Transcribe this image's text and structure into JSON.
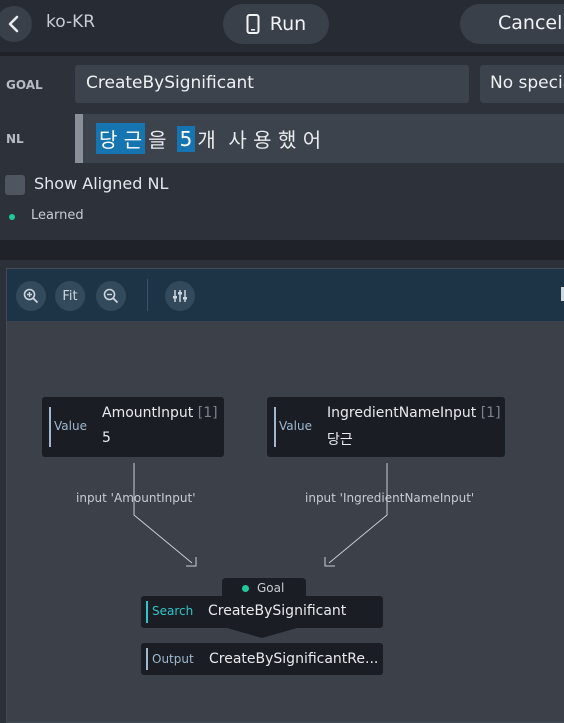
{
  "header": {
    "locale": "ko-KR",
    "run_label": "Run",
    "cancel_label": "Cancel"
  },
  "form": {
    "goal_label": "GOAL",
    "goal_value": "CreateBySignificant",
    "special_value": "No special",
    "nl_label": "NL",
    "nl_tokens": [
      {
        "text": "당 근",
        "highlight": true
      },
      {
        "text": "을",
        "highlight": false
      },
      {
        "text": "5",
        "highlight": true
      },
      {
        "text": "개  사 용 했 어",
        "highlight": false
      }
    ],
    "show_aligned_label": "Show Aligned NL",
    "status_label": "Learned"
  },
  "toolbar": {
    "zoom_in_icon": "zoom-in-icon",
    "fit_label": "Fit",
    "zoom_out_icon": "zoom-out-icon",
    "settings_icon": "sliders-icon"
  },
  "graph": {
    "amount_node": {
      "kind": "Value",
      "title": "AmountInput",
      "count": "[1]",
      "value": "5"
    },
    "ingredient_node": {
      "kind": "Value",
      "title": "IngredientNameInput",
      "count": "[1]",
      "value": "당근"
    },
    "edge_amount": "input 'AmountInput'",
    "edge_ingredient": "input 'IngredientNameInput'",
    "goal_tab": "Goal",
    "search_node": {
      "kind": "Search",
      "title": "CreateBySignificant"
    },
    "output_node": {
      "kind": "Output",
      "title": "CreateBySignificantRe..."
    }
  },
  "colors": {
    "highlight": "#1674b0",
    "accent_green": "#1fc99a",
    "search_accent": "#2fc4c7"
  }
}
